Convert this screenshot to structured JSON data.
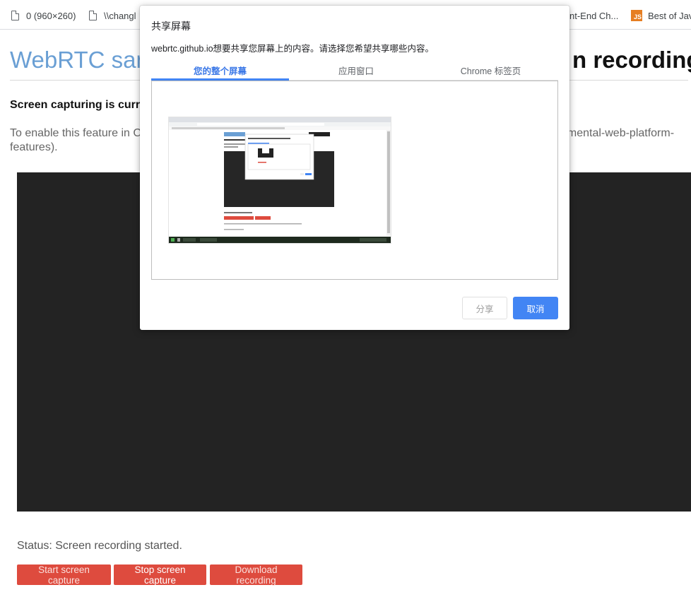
{
  "bookmarks": [
    {
      "label": "0 (960×260)",
      "icon": "page-icon"
    },
    {
      "label": "\\\\changl",
      "icon": "page-icon"
    },
    {
      "label": "nt-End Ch...",
      "icon": "none"
    },
    {
      "label": "Best of Jav",
      "icon": "js-icon"
    }
  ],
  "page": {
    "title_left": "WebRTC sam",
    "title_right": "n recording",
    "warning": "Screen capturing is curre",
    "enable_line1_left": "To enable this feature in Ch",
    "enable_line1_right": "rimental-web-platform-",
    "enable_line2": "features).",
    "video_bg": "#232323",
    "status": "Status: Screen recording started.",
    "buttons": {
      "start": "Start screen capture",
      "stop": "Stop screen capture",
      "download": "Download recording"
    },
    "button_color": "#de4b3e"
  },
  "dialog": {
    "title": "共享屏幕",
    "description": "webrtc.github.io想要共享您屏幕上的内容。请选择您希望共享哪些内容。",
    "tabs": [
      {
        "label": "您的整个屏幕",
        "active": true
      },
      {
        "label": "应用窗口",
        "active": false
      },
      {
        "label": "Chrome 标签页",
        "active": false
      }
    ],
    "share_button": "分享",
    "cancel_button": "取消",
    "accent": "#4285f4"
  }
}
